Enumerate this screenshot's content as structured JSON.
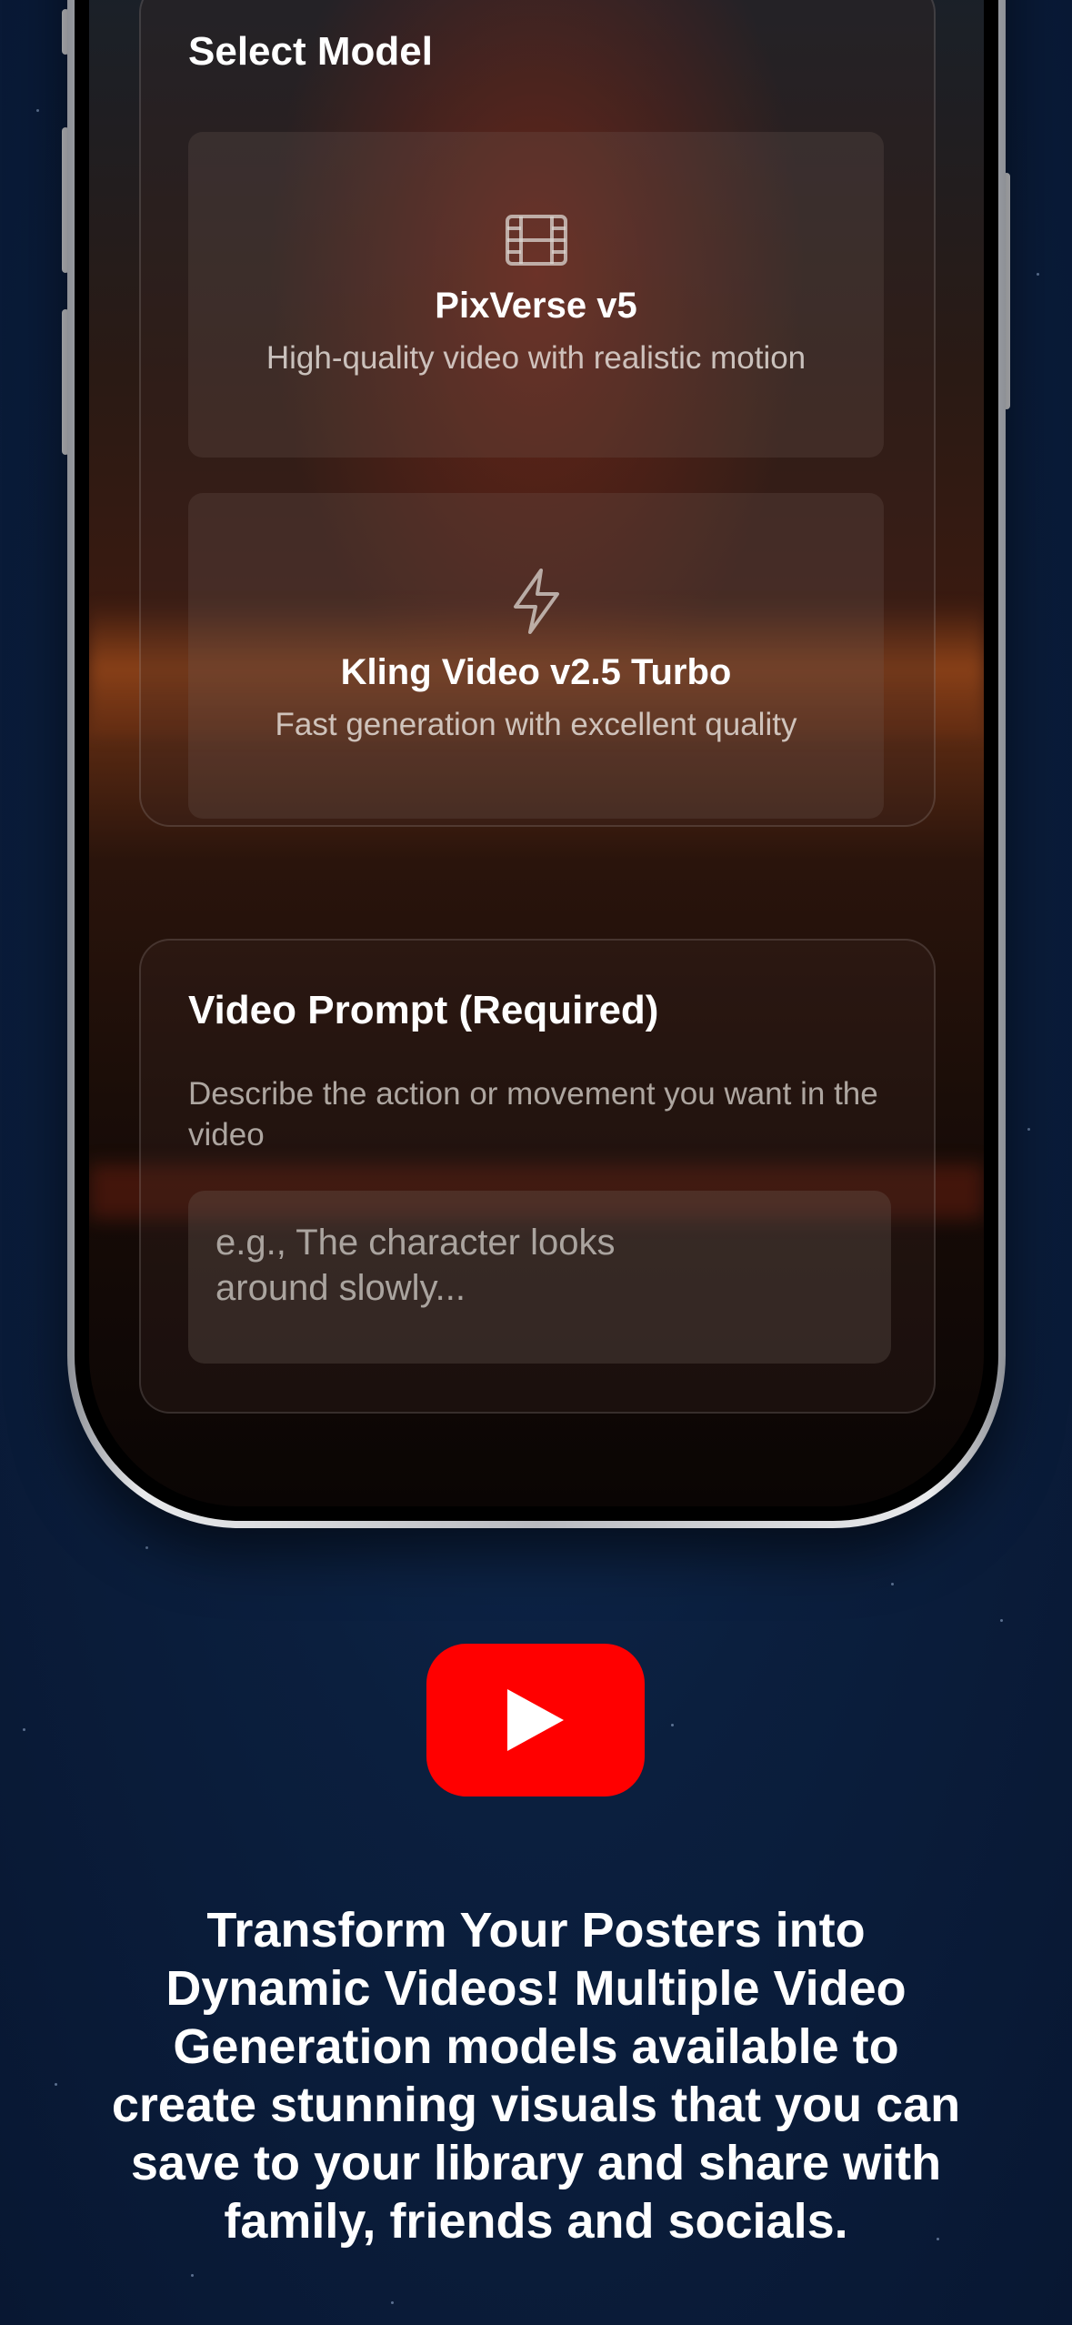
{
  "select_model": {
    "title": "Select Model",
    "models": [
      {
        "name": "PixVerse v5",
        "description": "High-quality video with realistic motion",
        "icon": "film-icon"
      },
      {
        "name": "Kling Video v2.5 Turbo",
        "description": "Fast generation with excellent quality",
        "icon": "lightning-icon"
      }
    ]
  },
  "video_prompt": {
    "title": "Video Prompt (Required)",
    "description": "Describe the action or movement you want in the video",
    "placeholder": "e.g., The character looks around slowly..."
  },
  "promo": {
    "logo": "youtube-play-icon",
    "tagline": "Transform Your Posters into Dynamic Videos! Multiple Video Generation models available to create stunning visuals that you can save to your library and share with family, friends and socials."
  },
  "colors": {
    "background": "#0b1f3e",
    "youtube_red": "#ff0000",
    "text": "#ffffff"
  }
}
